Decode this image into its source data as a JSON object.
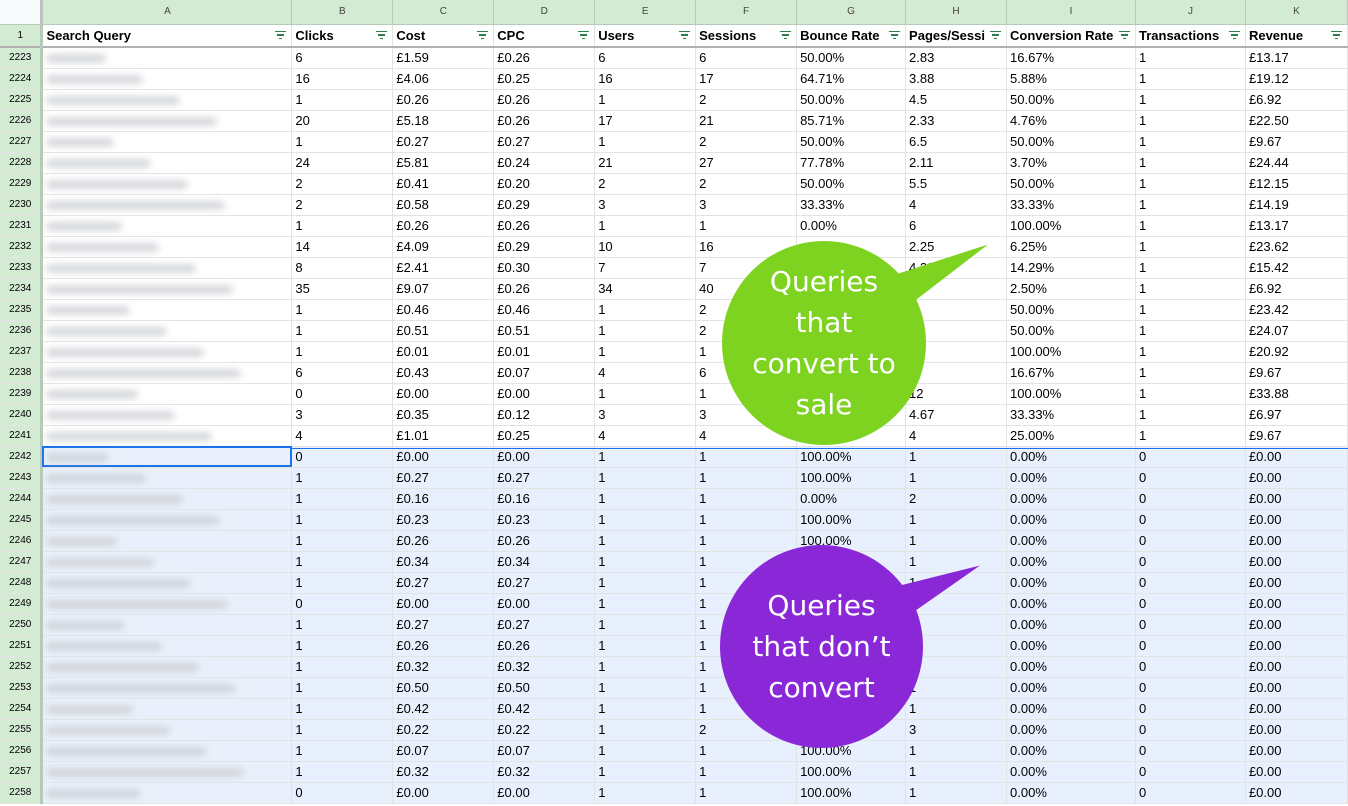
{
  "column_letters": [
    "A",
    "B",
    "C",
    "D",
    "E",
    "F",
    "G",
    "H",
    "I",
    "J",
    "K"
  ],
  "header_row_number": "1",
  "headers": [
    "Search Query",
    "Clicks",
    "Cost",
    "CPC",
    "Users",
    "Sessions",
    "Bounce Rate",
    "Pages/Sessi",
    "Conversion Rate",
    "Transactions",
    "Revenue"
  ],
  "rows": [
    {
      "n": "2223",
      "c": [
        "6",
        "£1.59",
        "£0.26",
        "6",
        "6",
        "50.00%",
        "2.83",
        "16.67%",
        "1",
        "£13.17"
      ]
    },
    {
      "n": "2224",
      "c": [
        "16",
        "£4.06",
        "£0.25",
        "16",
        "17",
        "64.71%",
        "3.88",
        "5.88%",
        "1",
        "£19.12"
      ]
    },
    {
      "n": "2225",
      "c": [
        "1",
        "£0.26",
        "£0.26",
        "1",
        "2",
        "50.00%",
        "4.5",
        "50.00%",
        "1",
        "£6.92"
      ]
    },
    {
      "n": "2226",
      "c": [
        "20",
        "£5.18",
        "£0.26",
        "17",
        "21",
        "85.71%",
        "2.33",
        "4.76%",
        "1",
        "£22.50"
      ]
    },
    {
      "n": "2227",
      "c": [
        "1",
        "£0.27",
        "£0.27",
        "1",
        "2",
        "50.00%",
        "6.5",
        "50.00%",
        "1",
        "£9.67"
      ]
    },
    {
      "n": "2228",
      "c": [
        "24",
        "£5.81",
        "£0.24",
        "21",
        "27",
        "77.78%",
        "2.11",
        "3.70%",
        "1",
        "£24.44"
      ]
    },
    {
      "n": "2229",
      "c": [
        "2",
        "£0.41",
        "£0.20",
        "2",
        "2",
        "50.00%",
        "5.5",
        "50.00%",
        "1",
        "£12.15"
      ]
    },
    {
      "n": "2230",
      "c": [
        "2",
        "£0.58",
        "£0.29",
        "3",
        "3",
        "33.33%",
        "4",
        "33.33%",
        "1",
        "£14.19"
      ]
    },
    {
      "n": "2231",
      "c": [
        "1",
        "£0.26",
        "£0.26",
        "1",
        "1",
        "0.00%",
        "6",
        "100.00%",
        "1",
        "£13.17"
      ]
    },
    {
      "n": "2232",
      "c": [
        "14",
        "£4.09",
        "£0.29",
        "10",
        "16",
        "",
        "2.25",
        "6.25%",
        "1",
        "£23.62"
      ]
    },
    {
      "n": "2233",
      "c": [
        "8",
        "£2.41",
        "£0.30",
        "7",
        "7",
        "",
        "4.29",
        "14.29%",
        "1",
        "£15.42"
      ]
    },
    {
      "n": "2234",
      "c": [
        "35",
        "£9.07",
        "£0.26",
        "34",
        "40",
        "",
        "",
        "2.50%",
        "1",
        "£6.92"
      ]
    },
    {
      "n": "2235",
      "c": [
        "1",
        "£0.46",
        "£0.46",
        "1",
        "2",
        "",
        "",
        "50.00%",
        "1",
        "£23.42"
      ]
    },
    {
      "n": "2236",
      "c": [
        "1",
        "£0.51",
        "£0.51",
        "1",
        "2",
        "",
        "",
        "50.00%",
        "1",
        "£24.07"
      ]
    },
    {
      "n": "2237",
      "c": [
        "1",
        "£0.01",
        "£0.01",
        "1",
        "1",
        "",
        "",
        "100.00%",
        "1",
        "£20.92"
      ]
    },
    {
      "n": "2238",
      "c": [
        "6",
        "£0.43",
        "£0.07",
        "4",
        "6",
        "",
        "",
        "16.67%",
        "1",
        "£9.67"
      ]
    },
    {
      "n": "2239",
      "c": [
        "0",
        "£0.00",
        "£0.00",
        "1",
        "1",
        "",
        "12",
        "100.00%",
        "1",
        "£33.88"
      ]
    },
    {
      "n": "2240",
      "c": [
        "3",
        "£0.35",
        "£0.12",
        "3",
        "3",
        "",
        "4.67",
        "33.33%",
        "1",
        "£6.97"
      ]
    },
    {
      "n": "2241",
      "c": [
        "4",
        "£1.01",
        "£0.25",
        "4",
        "4",
        "25.00%",
        "4",
        "25.00%",
        "1",
        "£9.67"
      ]
    },
    {
      "n": "2242",
      "c": [
        "0",
        "£0.00",
        "£0.00",
        "1",
        "1",
        "100.00%",
        "1",
        "0.00%",
        "0",
        "£0.00"
      ]
    },
    {
      "n": "2243",
      "c": [
        "1",
        "£0.27",
        "£0.27",
        "1",
        "1",
        "100.00%",
        "1",
        "0.00%",
        "0",
        "£0.00"
      ]
    },
    {
      "n": "2244",
      "c": [
        "1",
        "£0.16",
        "£0.16",
        "1",
        "1",
        "0.00%",
        "2",
        "0.00%",
        "0",
        "£0.00"
      ]
    },
    {
      "n": "2245",
      "c": [
        "1",
        "£0.23",
        "£0.23",
        "1",
        "1",
        "100.00%",
        "1",
        "0.00%",
        "0",
        "£0.00"
      ]
    },
    {
      "n": "2246",
      "c": [
        "1",
        "£0.26",
        "£0.26",
        "1",
        "1",
        "100.00%",
        "1",
        "0.00%",
        "0",
        "£0.00"
      ]
    },
    {
      "n": "2247",
      "c": [
        "1",
        "£0.34",
        "£0.34",
        "1",
        "1",
        "",
        "1",
        "0.00%",
        "0",
        "£0.00"
      ]
    },
    {
      "n": "2248",
      "c": [
        "1",
        "£0.27",
        "£0.27",
        "1",
        "1",
        "",
        "1",
        "0.00%",
        "0",
        "£0.00"
      ]
    },
    {
      "n": "2249",
      "c": [
        "0",
        "£0.00",
        "£0.00",
        "1",
        "1",
        "",
        "",
        "0.00%",
        "0",
        "£0.00"
      ]
    },
    {
      "n": "2250",
      "c": [
        "1",
        "£0.27",
        "£0.27",
        "1",
        "1",
        "",
        "",
        "0.00%",
        "0",
        "£0.00"
      ]
    },
    {
      "n": "2251",
      "c": [
        "1",
        "£0.26",
        "£0.26",
        "1",
        "1",
        "",
        "",
        "0.00%",
        "0",
        "£0.00"
      ]
    },
    {
      "n": "2252",
      "c": [
        "1",
        "£0.32",
        "£0.32",
        "1",
        "1",
        "",
        "",
        "0.00%",
        "0",
        "£0.00"
      ]
    },
    {
      "n": "2253",
      "c": [
        "1",
        "£0.50",
        "£0.50",
        "1",
        "1",
        "",
        "1",
        "0.00%",
        "0",
        "£0.00"
      ]
    },
    {
      "n": "2254",
      "c": [
        "1",
        "£0.42",
        "£0.42",
        "1",
        "1",
        "",
        "1",
        "0.00%",
        "0",
        "£0.00"
      ]
    },
    {
      "n": "2255",
      "c": [
        "1",
        "£0.22",
        "£0.22",
        "1",
        "2",
        "0.00%",
        "3",
        "0.00%",
        "0",
        "£0.00"
      ]
    },
    {
      "n": "2256",
      "c": [
        "1",
        "£0.07",
        "£0.07",
        "1",
        "1",
        "100.00%",
        "1",
        "0.00%",
        "0",
        "£0.00"
      ]
    },
    {
      "n": "2257",
      "c": [
        "1",
        "£0.32",
        "£0.32",
        "1",
        "1",
        "100.00%",
        "1",
        "0.00%",
        "0",
        "£0.00"
      ]
    },
    {
      "n": "2258",
      "c": [
        "0",
        "£0.00",
        "£0.00",
        "1",
        "1",
        "100.00%",
        "1",
        "0.00%",
        "0",
        "£0.00"
      ]
    }
  ],
  "selected_from_row": "2242",
  "callouts": {
    "convert": {
      "lines": [
        "Queries",
        "that",
        "convert to",
        "sale"
      ],
      "color": "#7ed321"
    },
    "no_convert": {
      "lines": [
        "Queries",
        "that don’t",
        "convert"
      ],
      "color": "#8a28d8"
    }
  },
  "colors": {
    "header_bg": "#d3ead3",
    "selection_bg": "#e8f0fe",
    "selection_border": "#1a73e8"
  }
}
